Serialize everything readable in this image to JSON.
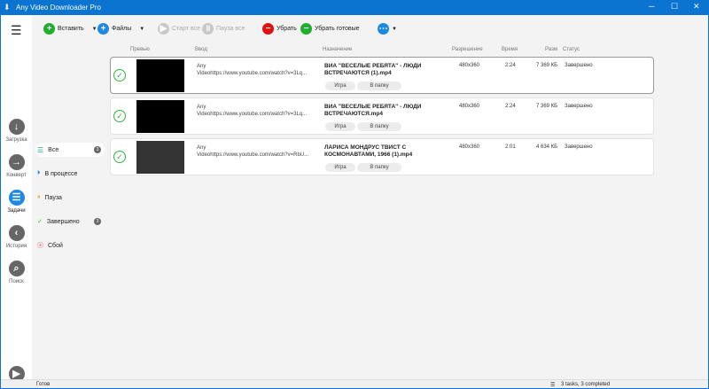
{
  "window": {
    "title": "Any Video Downloader Pro",
    "minimize": "─",
    "maximize": "☐",
    "close": "✕"
  },
  "toolbar": {
    "paste": "Вставить",
    "files": "Файлы",
    "start_all": "Старт все",
    "pause_all": "Пауза все",
    "remove": "Убрать",
    "remove_done": "Убрать готовые"
  },
  "rail": [
    {
      "label": "Загрузка",
      "icon": "download-icon"
    },
    {
      "label": "Конверт",
      "icon": "arrow-right-icon"
    },
    {
      "label": "Задачи",
      "icon": "list-icon",
      "active": true
    },
    {
      "label": "История",
      "icon": "back-icon"
    },
    {
      "label": "Поиск",
      "icon": "search-icon"
    }
  ],
  "filters": [
    {
      "label": "Все",
      "count": "3"
    },
    {
      "label": "В процессе"
    },
    {
      "label": "Пауза"
    },
    {
      "label": "Завершено",
      "count": "3"
    },
    {
      "label": "Сбой"
    }
  ],
  "columns": {
    "preview": "Превью",
    "input": "Ввод",
    "dest": "Назначение",
    "res": "Разрешение",
    "time": "Время",
    "size": "Разм",
    "status": "Статус"
  },
  "rows": [
    {
      "src1": "Any",
      "src2": "Videohttps://www.youtube.com/watch?v=3Lq...",
      "dest": "ВИА \"ВЕСЕЛЫЕ РЕБЯТА\" - ЛЮДИ ВСТРЕЧАЮТСЯ (1).mp4",
      "res": "480x360",
      "time": "2:24",
      "size": "7 369 КБ",
      "status": "Завершено",
      "play": "Игра",
      "folder": "В папку"
    },
    {
      "src1": "Any",
      "src2": "Videohttps://www.youtube.com/watch?v=3Lq...",
      "dest": "ВИА \"ВЕСЕЛЫЕ РЕБЯТА\" - ЛЮДИ ВСТРЕЧАЮТСЯ.mp4",
      "res": "480x360",
      "time": "2:24",
      "size": "7 369 КБ",
      "status": "Завершено",
      "play": "Игра",
      "folder": "В папку"
    },
    {
      "src1": "Any",
      "src2": "Videohttps://www.youtube.com/watch?v=RbU...",
      "dest": "ЛАРИСА МОНДРУС  ТВИСТ С КОСМОНАВТАМИ, 1966 (1).mp4",
      "res": "480x360",
      "time": "2:01",
      "size": "4 634 КБ",
      "status": "Завершено",
      "play": "Игра",
      "folder": "В папку"
    }
  ],
  "statusbar": {
    "left": "Готов",
    "right": "3 tasks, 3 completed"
  },
  "colors": {
    "accent": "#0a74d0",
    "green": "#1fae2e",
    "red": "#e01010",
    "blue": "#1e88e5"
  }
}
